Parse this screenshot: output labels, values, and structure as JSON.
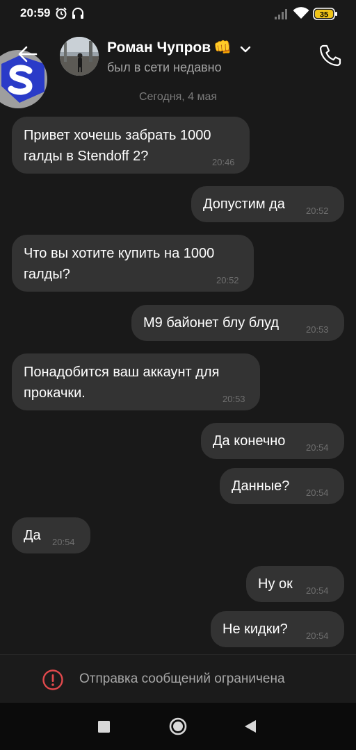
{
  "status_bar": {
    "time": "20:59",
    "battery": "35",
    "icons": [
      "alarm-icon",
      "headphones-icon",
      "signal-icon",
      "wifi-icon",
      "battery-icon"
    ]
  },
  "header": {
    "contact_name": "Роман Чупров",
    "contact_emoji": "👊",
    "status": "был в сети недавно",
    "icons": [
      "back-arrow-icon",
      "chevron-down-icon",
      "phone-icon"
    ]
  },
  "date_label": "Сегодня, 4 мая",
  "messages": [
    {
      "side": "in",
      "lines": [
        "Привет хочешь забрать 1000",
        "галды в Stendoff 2?"
      ],
      "time": "20:46"
    },
    {
      "side": "out",
      "lines": [
        "Допустим да"
      ],
      "time": "20:52"
    },
    {
      "side": "in",
      "lines": [
        "Что вы хотите купить на 1000",
        "галды?"
      ],
      "time": "20:52"
    },
    {
      "side": "out",
      "lines": [
        "M9 байонет блу блуд"
      ],
      "time": "20:53"
    },
    {
      "side": "in",
      "lines": [
        "Понадобится ваш аккаунт для",
        "прокачки."
      ],
      "time": "20:53"
    },
    {
      "side": "out",
      "lines": [
        "Да конечно"
      ],
      "time": "20:54"
    },
    {
      "side": "out",
      "lines": [
        "Данные?"
      ],
      "time": "20:54"
    },
    {
      "side": "in",
      "lines": [
        "Да"
      ],
      "time": "20:54"
    },
    {
      "side": "out",
      "lines": [
        "Ну ок"
      ],
      "time": "20:54"
    },
    {
      "side": "out",
      "lines": [
        "Не кидки?"
      ],
      "time": "20:54"
    }
  ],
  "restriction": {
    "text": "Отправка сообщений ограничена",
    "icon": "alert-circle-icon",
    "color": "#e0494c"
  },
  "nav_bar": {
    "icons": [
      "recents-square-icon",
      "home-circle-icon",
      "back-triangle-icon"
    ]
  },
  "colors": {
    "background": "#191919",
    "bubble": "#333333",
    "secondary_text": "#a3a3a3"
  }
}
